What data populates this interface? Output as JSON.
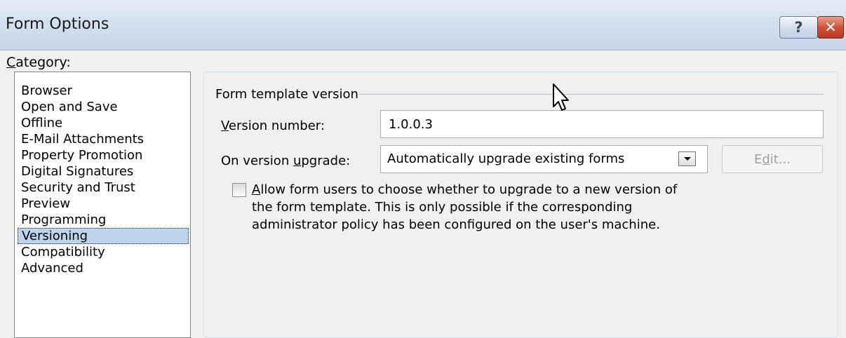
{
  "window": {
    "title": "Form Options",
    "help_label": "?",
    "close_label": "✕"
  },
  "category": {
    "label_prefix": "",
    "label_underline": "C",
    "label_suffix": "ategory:",
    "selected": "Versioning",
    "items": [
      {
        "label": "Browser"
      },
      {
        "label": "Open and Save"
      },
      {
        "label": "Offline"
      },
      {
        "label": "E-Mail Attachments"
      },
      {
        "label": "Property Promotion"
      },
      {
        "label": "Digital Signatures"
      },
      {
        "label": "Security and Trust"
      },
      {
        "label": "Preview"
      },
      {
        "label": "Programming"
      },
      {
        "label": "Versioning"
      },
      {
        "label": "Compatibility"
      },
      {
        "label": "Advanced"
      }
    ]
  },
  "versioning": {
    "group_title": "Form template version",
    "version_label": {
      "prefix": "",
      "underline": "V",
      "suffix": "ersion number:"
    },
    "version_value": "1.0.0.3",
    "upgrade_label": {
      "prefix": "On version ",
      "underline": "u",
      "suffix": "pgrade:"
    },
    "upgrade_value": "Automatically upgrade existing forms",
    "edit_button": {
      "prefix": "E",
      "underline": "d",
      "suffix": "it..."
    },
    "allow": {
      "checked": false,
      "underline": "A",
      "text": "llow form users to choose whether to upgrade to a new version of the form template. This is only possible if the corresponding administrator policy has been configured on the user's machine."
    }
  },
  "colors": {
    "selection": "#bcd4ec",
    "title_bar": "#d3e0ee",
    "close_button": "#c7432b"
  },
  "icons": {
    "dropdown": "chevron-down-icon",
    "cursor": "mouse-pointer-icon"
  }
}
